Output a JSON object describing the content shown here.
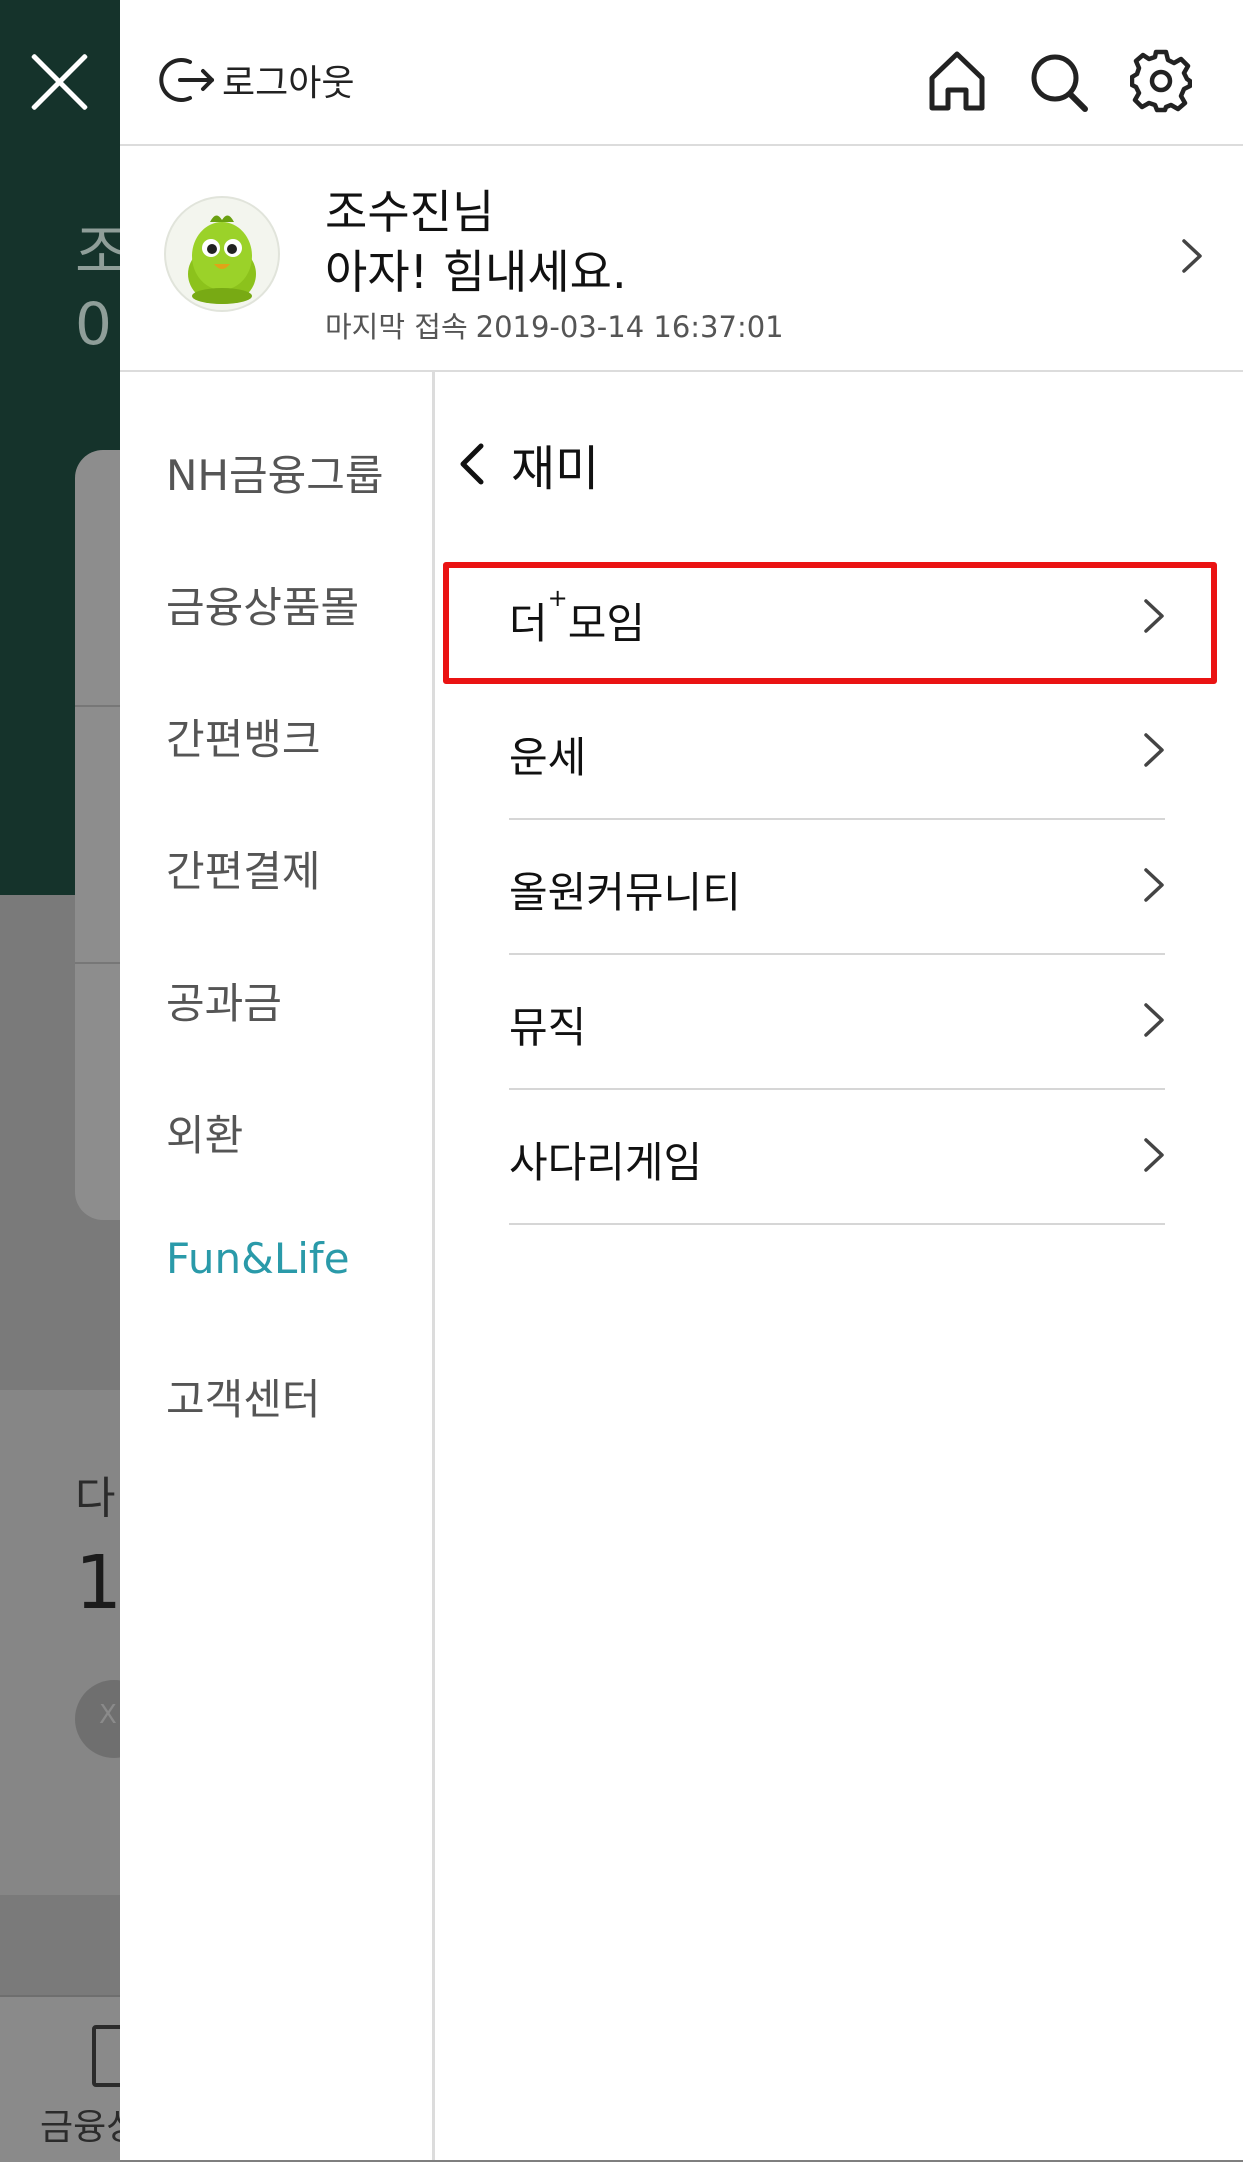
{
  "background": {
    "text_partial_1": "조",
    "text_partial_2": "0",
    "text_partial_3": "다",
    "text_partial_4": "1",
    "circle_label": "X",
    "footer_label": "금융상"
  },
  "header": {
    "logout_label": "로그아웃",
    "icons": [
      "home-icon",
      "search-icon",
      "settings-icon"
    ]
  },
  "profile": {
    "name": "조수진님",
    "message": "아자! 힘내세요.",
    "last_login_label": "마지막 접속",
    "last_login_value": "2019-03-14 16:37:01"
  },
  "categories": [
    {
      "label": "NH금융그룹",
      "active": false
    },
    {
      "label": "금융상품몰",
      "active": false
    },
    {
      "label": "간편뱅크",
      "active": false
    },
    {
      "label": "간편결제",
      "active": false
    },
    {
      "label": "공과금",
      "active": false
    },
    {
      "label": "외환",
      "active": false
    },
    {
      "label": "Fun&Life",
      "active": true
    },
    {
      "label": "고객센터",
      "active": false
    }
  ],
  "submenu": {
    "title": "재미",
    "items": [
      {
        "label_main": "더",
        "label_sup": "+",
        "label_rest": "모임",
        "highlighted": true
      },
      {
        "label": "운세"
      },
      {
        "label": "올원커뮤니티"
      },
      {
        "label": "뮤직"
      },
      {
        "label": "사다리게임"
      }
    ]
  },
  "colors": {
    "accent_teal": "#2a9aa9",
    "highlight_red": "#ea1313",
    "drawer_bg": "#ffffff",
    "dim_overlay": "#7f7f7f",
    "dark_bg": "#15332b"
  }
}
